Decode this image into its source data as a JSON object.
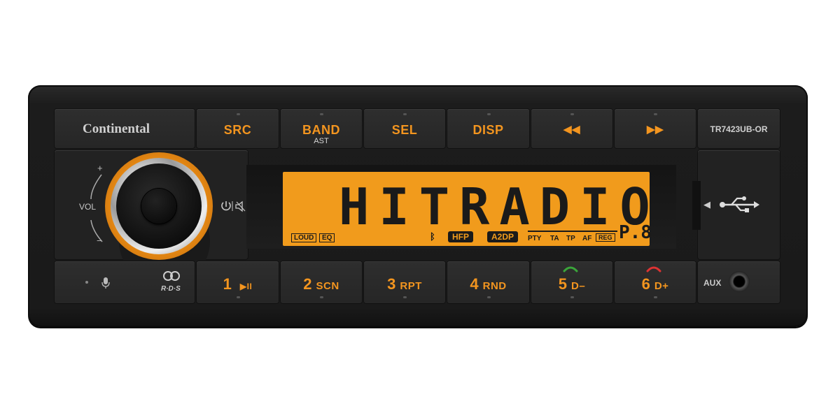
{
  "brand": "Continental",
  "model": "TR7423UB-OR",
  "top_buttons": [
    {
      "label": "SRC",
      "sub": ""
    },
    {
      "label": "BAND",
      "sub": "AST"
    },
    {
      "label": "SEL",
      "sub": ""
    },
    {
      "label": "DISP",
      "sub": ""
    },
    {
      "label": "◀◀",
      "sub": ""
    },
    {
      "label": "▶▶",
      "sub": ""
    }
  ],
  "volume": {
    "label": "VOL",
    "plus": "+",
    "minus": "−"
  },
  "power_icon": "power-mute-icon",
  "display": {
    "text": "HITRADIO",
    "loud": "LOUD",
    "eq": "EQ",
    "hfp": "HFP",
    "a2dp": "A2DP",
    "pty": "PTY",
    "ta": "TA",
    "tp": "TP",
    "af": "AF",
    "reg": "REG",
    "preset": "P.8"
  },
  "bottom_buttons": [
    {
      "num": "1",
      "label": "▶II"
    },
    {
      "num": "2",
      "label": "SCN"
    },
    {
      "num": "3",
      "label": "RPT"
    },
    {
      "num": "4",
      "label": "RND"
    },
    {
      "num": "5",
      "label": "D–"
    },
    {
      "num": "6",
      "label": "D+"
    }
  ],
  "rds": "R·D·S",
  "aux": "AUX",
  "usb_arrow": "◀",
  "colors": {
    "accent": "#f3951f",
    "lcd": "#f19b1c",
    "body": "#1e1e1e"
  }
}
